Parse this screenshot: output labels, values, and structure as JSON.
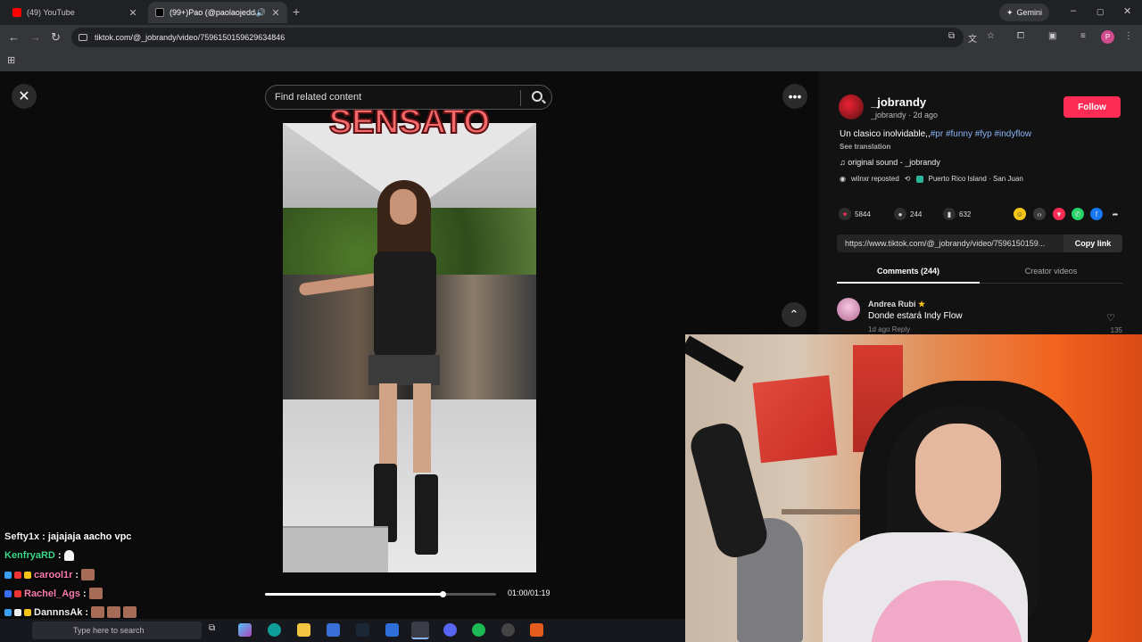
{
  "browser": {
    "tabs": [
      {
        "title": "(49) YouTube",
        "close": "✕",
        "favicon_color": "#ff0000"
      },
      {
        "title": "(99+)Pao (@paolaojedda) |",
        "close": "✕",
        "favicon_color": "#000000",
        "audio_icon": "speaker-icon"
      }
    ],
    "new_tab": "+",
    "gemini_label": "Gemini",
    "window_controls": [
      "–",
      "▢",
      "✕"
    ],
    "url": "tiktok.com/@_jobrandy/video/7596150159629634846",
    "profile_initial": "P"
  },
  "player": {
    "search_placeholder": "Find related content",
    "close": "✕",
    "more": "•••",
    "scroll_up": "⌃",
    "overlay_text": "SENSATO",
    "progress_fraction": 0.77,
    "timecode": "01:00/01:19"
  },
  "post": {
    "username": "_jobrandy",
    "meta": "_jobrandy · 2d ago",
    "follow_label": "Follow",
    "caption": "Un clasico inolvidable,,",
    "tags": "#pr #funny #fyp #indyflow",
    "see_translation": "See translation",
    "sound": "♫  original sound - _jobrandy",
    "reposted": "wilnxr reposted",
    "location": "Puerto Rico Island · San Juan"
  },
  "actions": {
    "likes": "5844",
    "comments": "244",
    "saves": "632"
  },
  "link": {
    "url": "https://www.tiktok.com/@_jobrandy/video/7596150159...",
    "copy_label": "Copy link"
  },
  "panel_tabs": [
    {
      "label": "Comments (244)"
    },
    {
      "label": "Creator videos"
    }
  ],
  "comment": {
    "name": "Andrea Rubi",
    "star": "★",
    "text": "Donde estará Indy Flow",
    "meta": "1d ago    Reply",
    "likes": "135"
  },
  "chat": [
    {
      "user": "Sefty1x",
      "msg": ": jajajaja aacho vpc"
    },
    {
      "user": "KenfryaRD",
      "msg": ":"
    },
    {
      "user": "carool1r",
      "msg": ":"
    },
    {
      "user": "Rachel_Ags",
      "msg": ":"
    },
    {
      "user": "DannnsAk",
      "msg": ":"
    },
    {
      "user": "KenfryaRD",
      "msg": ":"
    }
  ],
  "taskbar": {
    "search_placeholder": "Type here to search"
  }
}
